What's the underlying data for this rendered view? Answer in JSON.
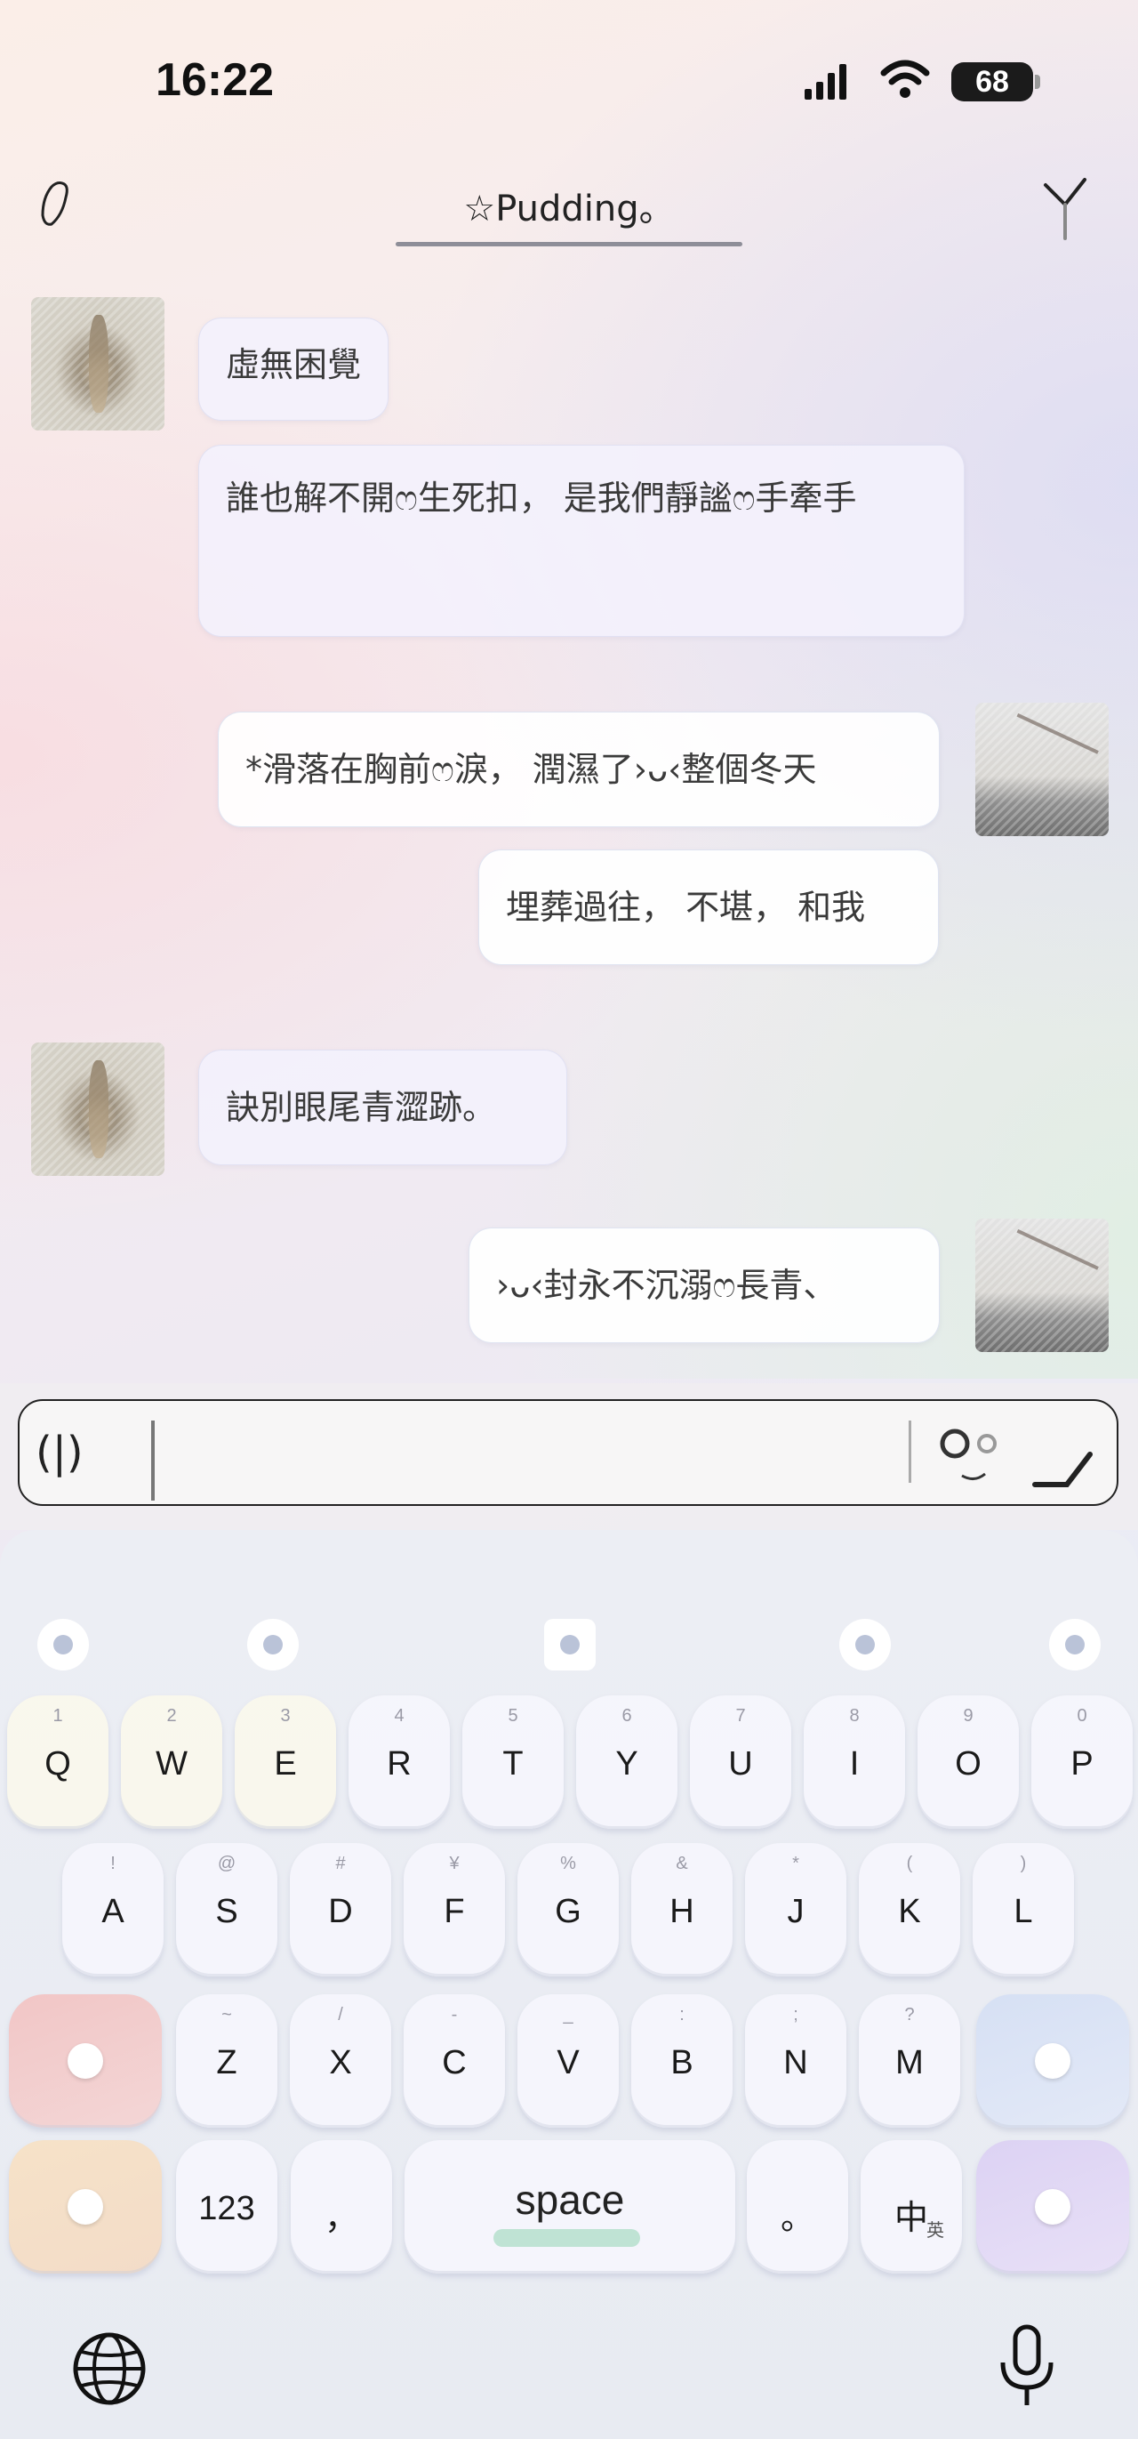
{
  "status": {
    "time": "16:22",
    "battery": "68"
  },
  "nav": {
    "title": "☆Pudding。"
  },
  "messages": [
    {
      "side": "left",
      "text": "虛無困覺"
    },
    {
      "side": "left",
      "text": "誰也解不開ෆ生死扣， 是我們靜謐ෆ手牽手"
    },
    {
      "side": "right",
      "text": "*滑落在胸前ෆ淚， 潤濕了›ᴗ‹整個冬天"
    },
    {
      "side": "right",
      "text": "埋葬過往， 不堪， 和我"
    },
    {
      "side": "left",
      "text": "訣別眼尾青澀跡。"
    },
    {
      "side": "right",
      "text": "›ᴗ‹封永不沉溺ෆ長青、"
    }
  ],
  "input": {
    "left_deco": "(|)"
  },
  "keyboard": {
    "row1": [
      {
        "label": "Q",
        "hint": "1"
      },
      {
        "label": "W",
        "hint": "2"
      },
      {
        "label": "E",
        "hint": "3"
      },
      {
        "label": "R",
        "hint": "4"
      },
      {
        "label": "T",
        "hint": "5"
      },
      {
        "label": "Y",
        "hint": "6"
      },
      {
        "label": "U",
        "hint": "7"
      },
      {
        "label": "I",
        "hint": "8"
      },
      {
        "label": "O",
        "hint": "9"
      },
      {
        "label": "P",
        "hint": "0"
      }
    ],
    "row2": [
      {
        "label": "A",
        "hint": "!"
      },
      {
        "label": "S",
        "hint": "@"
      },
      {
        "label": "D",
        "hint": "#"
      },
      {
        "label": "F",
        "hint": "¥"
      },
      {
        "label": "G",
        "hint": "%"
      },
      {
        "label": "H",
        "hint": "&"
      },
      {
        "label": "J",
        "hint": "*"
      },
      {
        "label": "K",
        "hint": "("
      },
      {
        "label": "L",
        "hint": ")"
      }
    ],
    "row3": [
      {
        "label": "Z",
        "hint": "~"
      },
      {
        "label": "X",
        "hint": "/"
      },
      {
        "label": "C",
        "hint": "-"
      },
      {
        "label": "V",
        "hint": "_"
      },
      {
        "label": "B",
        "hint": ":"
      },
      {
        "label": "N",
        "hint": ";"
      },
      {
        "label": "M",
        "hint": "?"
      }
    ],
    "numbers_label": "123",
    "comma_label": "，",
    "space_label": "space",
    "period_label": "。",
    "lang_label": "中",
    "lang_sub": "英"
  }
}
